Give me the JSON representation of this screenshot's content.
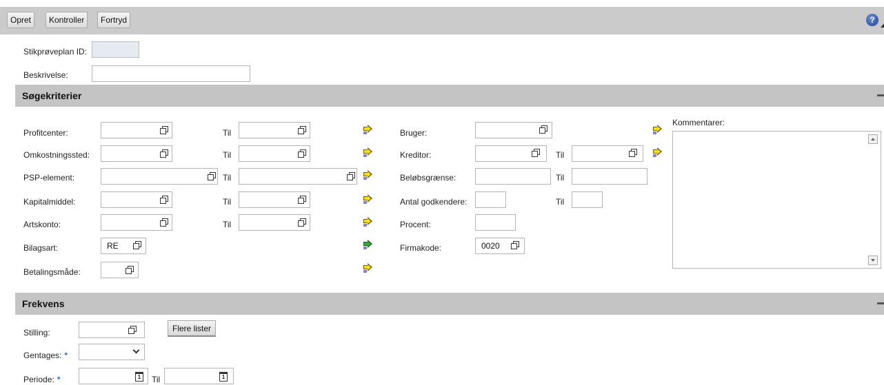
{
  "toolbar": {
    "buttons": [
      "Opret",
      "Kontroller",
      "Fortryd"
    ],
    "help_symbol": "?"
  },
  "header_fields": {
    "plan_id_label": "Stikprøveplan ID:",
    "plan_id_value": "",
    "description_label": "Beskrivelse:",
    "description_value": ""
  },
  "search_criteria": {
    "title": "Søgekriterier",
    "til": "Til",
    "profitcenter_label": "Profitcenter:",
    "cost_center_label": "Omkostningssted:",
    "psp_label": "PSP-element:",
    "asset_label": "Kapitalmiddel:",
    "account_label": "Artskonto:",
    "doc_type_label": "Bilagsart:",
    "doc_type_value": "RE",
    "payment_method_label": "Betalingsmåde:",
    "user_label": "Bruger:",
    "vendor_label": "Kreditor:",
    "amount_limit_label": "Beløbsgrænse:",
    "approver_count_label": "Antal godkendere:",
    "percent_label": "Procent:",
    "company_code_label": "Firmakode:",
    "company_code_value": "0020",
    "comments_label": "Kommentarer:",
    "comments_value": ""
  },
  "frequency": {
    "title": "Frekvens",
    "position_label": "Stilling:",
    "more_lists_button": "Flere lister",
    "repeats_label": "Gentages:",
    "repeats_value": "",
    "period_label": "Periode:",
    "period_til": "Til",
    "required_mark": "*",
    "calendar_day": "1"
  },
  "icons": {
    "f4": "value-help-icon",
    "arrow": "multiple-selection-arrow-icon",
    "calendar": "calendar-icon",
    "help": "help-icon"
  },
  "colors": {
    "section_bg": "#c4c4c4",
    "toolbar_bg": "#cbcbcb",
    "arrow_yellow": "#ffe000",
    "arrow_green": "#30b030",
    "required_blue": "#1e73d2"
  }
}
